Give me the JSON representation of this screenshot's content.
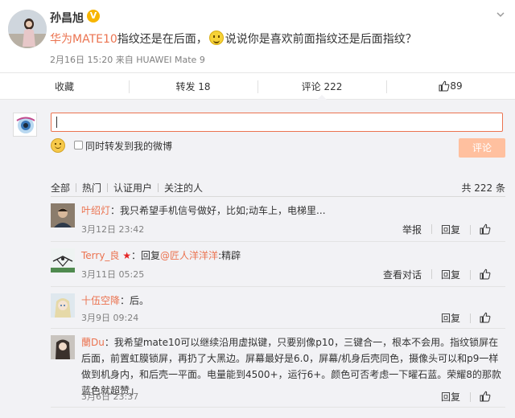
{
  "post": {
    "author": "孙昌旭",
    "verified_badge": "V",
    "text_highlight": "华为MATE10",
    "text_part1": "指纹还是在后面，",
    "text_part2": "说说你是喜欢前面指纹还是后面指纹？",
    "date": "2月16日 15:20",
    "source_prefix": "来自",
    "source": "HUAWEI Mate 9"
  },
  "actions": {
    "favorite": "收藏",
    "forward": "转发 18",
    "comment": "评论 222",
    "like": "89"
  },
  "composer": {
    "placeholder": "",
    "forward_label": "同时转发到我的微博",
    "submit_label": "评论"
  },
  "filters": {
    "all": "全部",
    "hot": "热门",
    "verified": "认证用户",
    "following": "关注的人",
    "total": "共 222 条"
  },
  "comments": [
    {
      "user": "叶绍灯",
      "text": "：我只希望手机信号做好，比如;动车上，电梯里...",
      "time": "3月12日 23:42",
      "ops": [
        "举报",
        "回复"
      ]
    },
    {
      "user": "Terry_良",
      "reply_prefix": "：回复",
      "reply_to": "@匠人洋洋洋",
      "text": ":精辟",
      "time": "3月11日 05:25",
      "ops": [
        "查看对话",
        "回复"
      ]
    },
    {
      "user": "十伍空降",
      "text": "：后。",
      "time": "3月9日 09:24",
      "ops": [
        "回复"
      ]
    },
    {
      "user": "蘭Du",
      "text": "：我希望mate10可以继续沿用虚拟键，只要别像p10，三键合一，根本不会用。指纹锁屏在后面，前置虹膜锁屏，再扔了大黑边。屏幕最好是6.0，屏幕/机身后壳同色，摄像头可以和p9一样做到机身内，和后壳一平面。电量能到4500+，运行6+。颜色可否考虑一下曜石蓝。荣耀8的那款蓝色就超赞」",
      "time": "3月6日 23:37",
      "ops": [
        "回复"
      ]
    }
  ],
  "colors": {
    "accent": "#eb7350",
    "background": "#f2f2f5",
    "submit_disabled": "#ffc09f"
  }
}
